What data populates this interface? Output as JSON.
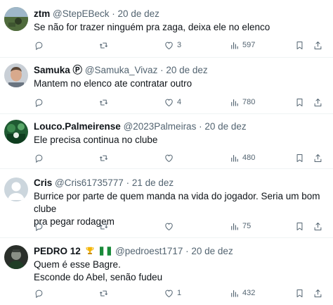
{
  "tweets": [
    {
      "name": "ztm",
      "handle": "@StepEBeck",
      "separator": "·",
      "date": "20 de dez",
      "text": "Se não for trazer ninguém pra zaga, deixa ele no elenco",
      "replies": "",
      "retweets": "",
      "likes": "3",
      "views": "597"
    },
    {
      "name": "Samuka",
      "name_badge": "Ⓟ",
      "handle": "@Samuka_Vivaz",
      "separator": "·",
      "date": "20 de dez",
      "text": "Mantem no elenco ate contratar outro",
      "replies": "",
      "retweets": "",
      "likes": "4",
      "views": "780"
    },
    {
      "name": "Louco.Palmeirense",
      "handle": "@2023Palmeiras",
      "separator": "·",
      "date": "20 de dez",
      "text": "Ele precisa continua no clube",
      "replies": "",
      "retweets": "",
      "likes": "",
      "views": "480"
    },
    {
      "name": "Cris",
      "handle": "@Cris61735777",
      "separator": "·",
      "date": "21 de dez",
      "text": "Burrice por parte de quem manda na vida do jogador. Seria um bom clube\npra pegar rodagem",
      "replies": "",
      "retweets": "",
      "likes": "",
      "views": "75"
    },
    {
      "name": "PEDRO 12",
      "handle": "@pedroest1717",
      "separator": "·",
      "date": "20 de dez",
      "text": "Quem é esse Bagre.\nEsconde do Abel, senão fudeu",
      "replies": "",
      "retweets": "",
      "likes": "1",
      "views": "432"
    }
  ],
  "icons": {
    "reply": "reply-icon",
    "retweet": "retweet-icon",
    "like": "like-icon",
    "views": "views-icon",
    "bookmark": "bookmark-icon",
    "share": "share-icon",
    "trophy": "trophy-icon",
    "flag": "nigeria-flag-icon"
  },
  "colors": {
    "text": "#0f1419",
    "secondary": "#536471",
    "divider": "#eff3f4",
    "background": "#ffffff"
  }
}
